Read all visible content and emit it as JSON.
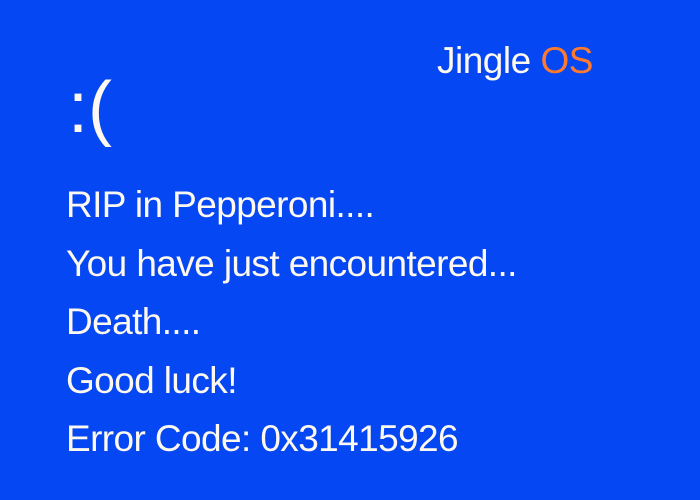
{
  "brand": {
    "name": "Jingle",
    "suffix": "OS",
    "suffix_color": "#FF7A2E"
  },
  "background_color": "#0547F2",
  "face": ":(",
  "messages": [
    "RIP in Pepperoni....",
    "You have just encountered...",
    "Death....",
    "Good luck!",
    "Error Code: 0x31415926"
  ]
}
